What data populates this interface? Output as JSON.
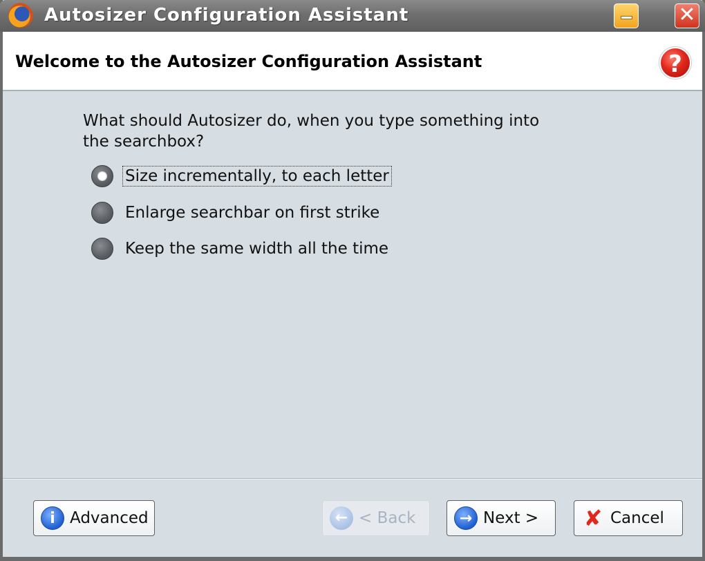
{
  "window": {
    "title": "Autosizer Configuration Assistant",
    "app_icon": "firefox-icon",
    "minimize_icon": "minimize-icon",
    "close_icon": "close-icon",
    "close_glyph": "✕"
  },
  "header": {
    "title": "Welcome to the Autosizer Configuration Assistant",
    "help_icon": "help-icon",
    "help_glyph": "?"
  },
  "content": {
    "question": "What should Autosizer do, when you type something into the searchbox?",
    "options": [
      {
        "label": "Size incrementally, to each letter",
        "selected": true
      },
      {
        "label": "Enlarge searchbar on first strike",
        "selected": false
      },
      {
        "label": "Keep the same width all the time",
        "selected": false
      }
    ]
  },
  "footer": {
    "advanced": {
      "label": "Advanced",
      "icon": "info-icon",
      "glyph": "i"
    },
    "back": {
      "label": "< Back",
      "icon": "back-arrow-icon",
      "glyph": "←",
      "disabled": true
    },
    "next": {
      "label": "Next >",
      "icon": "next-arrow-icon",
      "glyph": "→"
    },
    "cancel": {
      "label": "Cancel",
      "icon": "cancel-x-icon",
      "glyph": "✘"
    }
  }
}
